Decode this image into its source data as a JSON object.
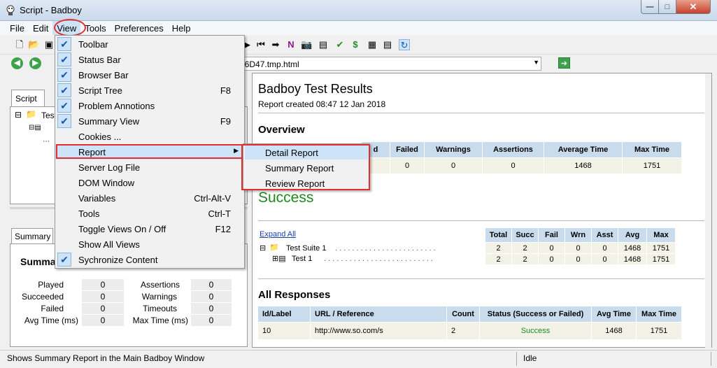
{
  "window": {
    "title": "Script - Badboy"
  },
  "menubar": [
    "File",
    "Edit",
    "View",
    "Tools",
    "Preferences",
    "Help"
  ],
  "address": {
    "url": "b6D47.tmp.html"
  },
  "left": {
    "script_tab": "Script",
    "tree_root": "Tes",
    "summary_tab": "Summary",
    "summary_title": "Summa",
    "stats": [
      {
        "label": "Played",
        "value": "0"
      },
      {
        "label": "Succeeded",
        "value": "0"
      },
      {
        "label": "Failed",
        "value": "0"
      },
      {
        "label": "Avg Time (ms)",
        "value": "0"
      },
      {
        "label": "Assertions",
        "value": "0"
      },
      {
        "label": "Warnings",
        "value": "0"
      },
      {
        "label": "Timeouts",
        "value": "0"
      },
      {
        "label": "Max Time (ms)",
        "value": "0"
      }
    ]
  },
  "report": {
    "title": "Badboy Test Results",
    "created": "Report created 08:47 12 Jan 2018",
    "overview_heading": "Overview",
    "overview_headers": [
      "d",
      "Failed",
      "Warnings",
      "Assertions",
      "Average Time",
      "Max Time"
    ],
    "overview_values": [
      "0",
      "0",
      "0",
      "1468",
      "1751"
    ],
    "status_big": "Success",
    "expand_all": "Expand All",
    "suite_headers": [
      "Total",
      "Succ",
      "Fail",
      "Wrn",
      "Asst",
      "Avg",
      "Max"
    ],
    "suite_rows": [
      {
        "name": "Test Suite 1",
        "values": [
          "2",
          "2",
          "0",
          "0",
          "0",
          "1468",
          "1751"
        ]
      },
      {
        "name": "Test 1",
        "values": [
          "2",
          "2",
          "0",
          "0",
          "0",
          "1468",
          "1751"
        ]
      }
    ],
    "responses_heading": "All Responses",
    "responses_headers": [
      "Id/Label",
      "URL / Reference",
      "Count",
      "Status (Success or Failed)",
      "Avg Time",
      "Max Time"
    ],
    "responses_row": [
      "10",
      "http://www.so.com/s",
      "2",
      "Success",
      "1468",
      "1751"
    ]
  },
  "view_menu": [
    {
      "label": "Toolbar",
      "checked": true,
      "shortcut": ""
    },
    {
      "label": "Status Bar",
      "checked": true,
      "shortcut": ""
    },
    {
      "label": "Browser Bar",
      "checked": true,
      "shortcut": ""
    },
    {
      "label": "Script Tree",
      "checked": true,
      "shortcut": "F8"
    },
    {
      "label": "Problem Annotions",
      "checked": true,
      "shortcut": ""
    },
    {
      "label": "Summary View",
      "checked": true,
      "shortcut": "F9"
    },
    {
      "label": "Cookies ...",
      "checked": false,
      "shortcut": ""
    },
    {
      "label": "Report",
      "checked": false,
      "shortcut": ""
    },
    {
      "label": "Server Log File",
      "checked": false,
      "shortcut": ""
    },
    {
      "label": "DOM Window",
      "checked": false,
      "shortcut": ""
    },
    {
      "label": "Variables",
      "checked": false,
      "shortcut": "Ctrl-Alt-V"
    },
    {
      "label": "Tools",
      "checked": false,
      "shortcut": "Ctrl-T"
    },
    {
      "label": "Toggle Views On / Off",
      "checked": false,
      "shortcut": "F12"
    },
    {
      "label": "Show All Views",
      "checked": false,
      "shortcut": ""
    },
    {
      "label": "Sychronize Content",
      "checked": true,
      "shortcut": ""
    }
  ],
  "report_submenu": [
    "Detail Report",
    "Summary Report",
    "Review Report"
  ],
  "status": {
    "message": "Shows Summary Report in the Main Badboy Window",
    "state": "Idle"
  },
  "colors": {
    "accent_highlight": "#e03030",
    "success": "#1e8a1e",
    "header_cell": "#c9dcee"
  }
}
